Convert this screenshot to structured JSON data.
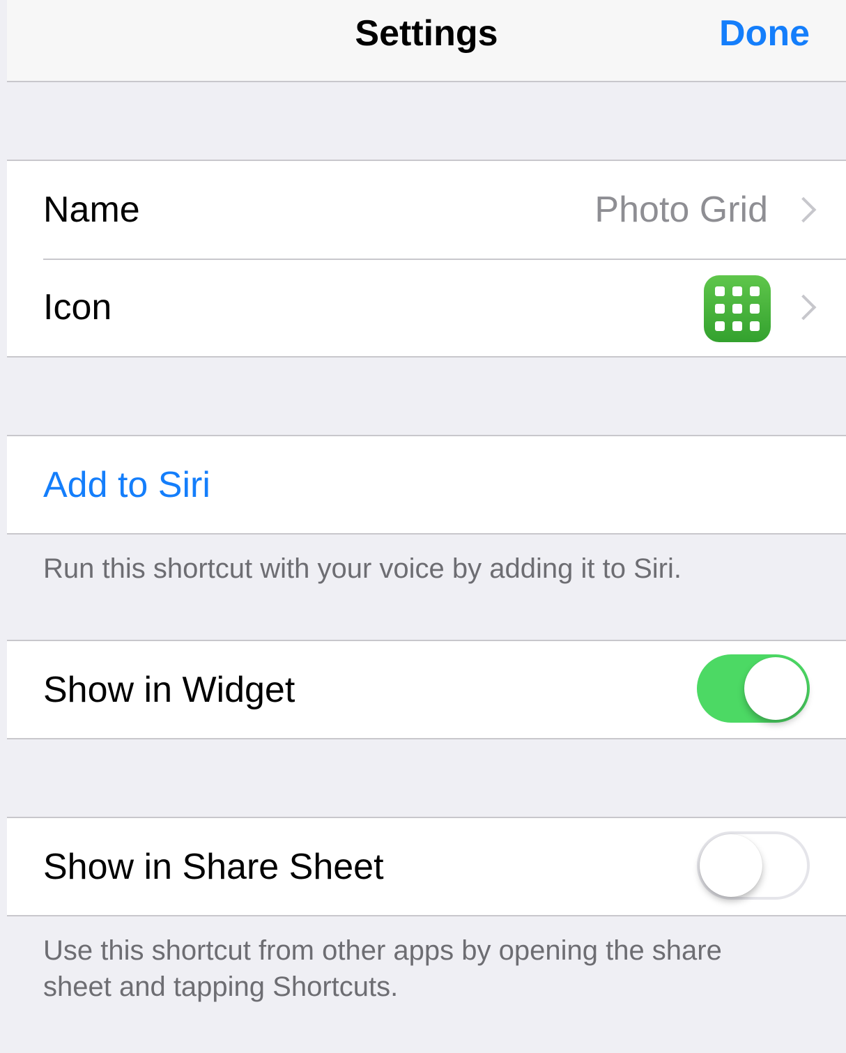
{
  "navbar": {
    "title": "Settings",
    "done_label": "Done"
  },
  "details": {
    "name_label": "Name",
    "name_value": "Photo Grid",
    "icon_label": "Icon",
    "icon_name": "grid-app-icon",
    "icon_color": "#4cb83c"
  },
  "siri": {
    "add_label": "Add to Siri",
    "footer": "Run this shortcut with your voice by adding it to Siri."
  },
  "widget": {
    "label": "Show in Widget",
    "enabled": true
  },
  "share_sheet": {
    "label": "Show in Share Sheet",
    "enabled": false,
    "footer_line1": "Use this shortcut from other apps by opening the share",
    "footer_line2": "sheet and tapping Shortcuts."
  },
  "colors": {
    "accent": "#147efb",
    "toggle_on": "#4cd964",
    "background": "#efeff4"
  }
}
